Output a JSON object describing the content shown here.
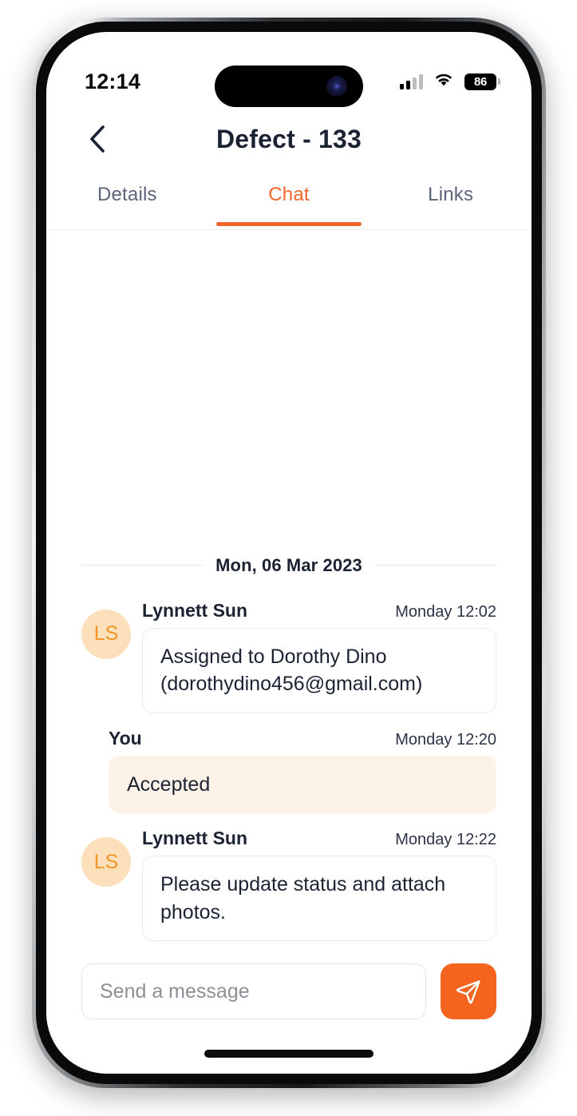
{
  "status_bar": {
    "time": "12:14",
    "battery_percent": "86",
    "signal_icon": "cellular-signal-icon",
    "wifi_icon": "wifi-icon",
    "battery_icon": "battery-icon"
  },
  "header": {
    "back_icon": "chevron-left-icon",
    "title": "Defect - 133"
  },
  "tabs": [
    {
      "label": "Details",
      "active": false
    },
    {
      "label": "Chat",
      "active": true
    },
    {
      "label": "Links",
      "active": false
    }
  ],
  "chat": {
    "date_divider": "Mon, 06 Mar 2023",
    "messages": [
      {
        "sender": "Lynnett Sun",
        "initials": "LS",
        "time": "Monday 12:02",
        "text": "Assigned to Dorothy Dino (dorothydino456@gmail.com)",
        "direction": "incoming"
      },
      {
        "sender": "You",
        "initials": "",
        "time": "Monday 12:20",
        "text": "Accepted",
        "direction": "outgoing"
      },
      {
        "sender": "Lynnett Sun",
        "initials": "LS",
        "time": "Monday 12:22",
        "text": "Please update status and attach photos.",
        "direction": "incoming"
      }
    ]
  },
  "composer": {
    "placeholder": "Send a message",
    "value": "",
    "send_icon": "send-paper-plane-icon"
  },
  "colors": {
    "accent": "#F2642A",
    "send_button": "#F4641F",
    "avatar_bg": "#FBE0BB",
    "avatar_text": "#F09628",
    "outgoing_bubble": "#FDF2E8",
    "text_primary": "#1B2333",
    "text_muted": "#5B6478"
  }
}
